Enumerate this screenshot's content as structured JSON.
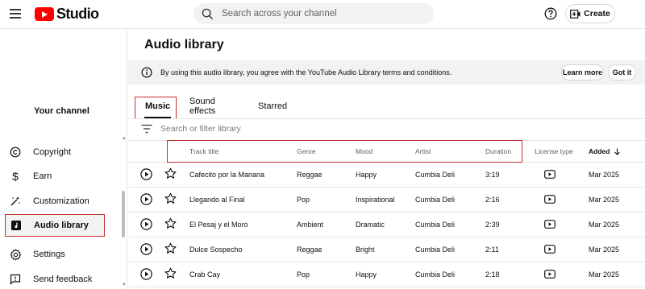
{
  "app": {
    "logo_text": "Studio"
  },
  "search": {
    "placeholder": "Search across your channel"
  },
  "header": {
    "create_label": "Create"
  },
  "sidebar": {
    "channel_label": "Your channel",
    "items": [
      {
        "label": "Copyright",
        "icon": "copyright-icon"
      },
      {
        "label": "Earn",
        "icon": "dollar-icon"
      },
      {
        "label": "Customization",
        "icon": "magic-wand-icon"
      },
      {
        "label": "Audio library",
        "icon": "audio-library-icon"
      },
      {
        "label": "Settings",
        "icon": "gear-icon"
      },
      {
        "label": "Send feedback",
        "icon": "feedback-icon"
      }
    ]
  },
  "main": {
    "title": "Audio library",
    "banner": {
      "text": "By using this audio library, you agree with the YouTube Audio Library terms and conditions.",
      "learn_more": "Learn more",
      "got_it": "Got it"
    },
    "tabs": [
      "Music",
      "Sound effects",
      "Starred"
    ],
    "filter_placeholder": "Search or filter library",
    "columns": {
      "title": "Track title",
      "genre": "Genre",
      "mood": "Mood",
      "artist": "Artist",
      "duration": "Duration",
      "license": "License type",
      "added": "Added"
    },
    "rows": [
      {
        "title": "Cafecito por la Manana",
        "genre": "Reggae",
        "mood": "Happy",
        "artist": "Cumbia Deli",
        "duration": "3:19",
        "added": "Mar 2025"
      },
      {
        "title": "Llegando al Final",
        "genre": "Pop",
        "mood": "Inspirational",
        "artist": "Cumbia Deli",
        "duration": "2:16",
        "added": "Mar 2025"
      },
      {
        "title": "El Pesaj y el Moro",
        "genre": "Ambient",
        "mood": "Dramatic",
        "artist": "Cumbia Deli",
        "duration": "2:39",
        "added": "Mar 2025"
      },
      {
        "title": "Dulce Sospecho",
        "genre": "Reggae",
        "mood": "Bright",
        "artist": "Cumbia Deli",
        "duration": "2:11",
        "added": "Mar 2025"
      },
      {
        "title": "Crab Cay",
        "genre": "Pop",
        "mood": "Happy",
        "artist": "Cumbia Deli",
        "duration": "2:18",
        "added": "Mar 2025"
      }
    ]
  },
  "colors": {
    "brand": "#ff0000",
    "highlight": "#c4302b"
  }
}
